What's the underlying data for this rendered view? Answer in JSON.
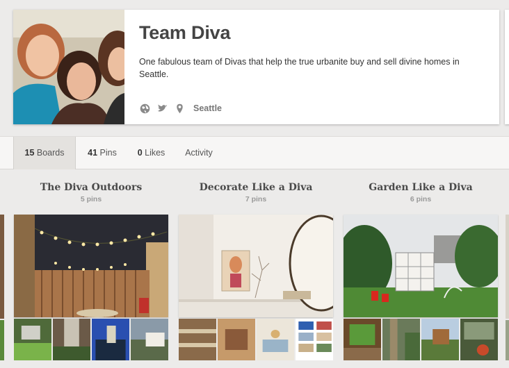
{
  "profile": {
    "name": "Team Diva",
    "description": "One fabulous team of Divas that help the true urbanite buy and sell divine homes in Seattle.",
    "location": "Seattle",
    "icons": [
      "globe-icon",
      "twitter-icon",
      "location-pin-icon"
    ]
  },
  "tabs": [
    {
      "count": "15",
      "label": " Boards",
      "active": true
    },
    {
      "count": "41",
      "label": " Pins",
      "active": false
    },
    {
      "count": "0",
      "label": " Likes",
      "active": false
    },
    {
      "count": "",
      "label": "Activity",
      "active": false
    }
  ],
  "boards": [
    {
      "title": "The Diva Outdoors",
      "pin_count": "5 pins"
    },
    {
      "title": "Decorate Like a Diva",
      "pin_count": "7 pins"
    },
    {
      "title": "Garden Like a Diva",
      "pin_count": "6 pins"
    }
  ],
  "colors": {
    "background": "#ecebea",
    "card": "#ffffff",
    "tab_active": "#e4e2df",
    "muted_text": "#999999"
  }
}
